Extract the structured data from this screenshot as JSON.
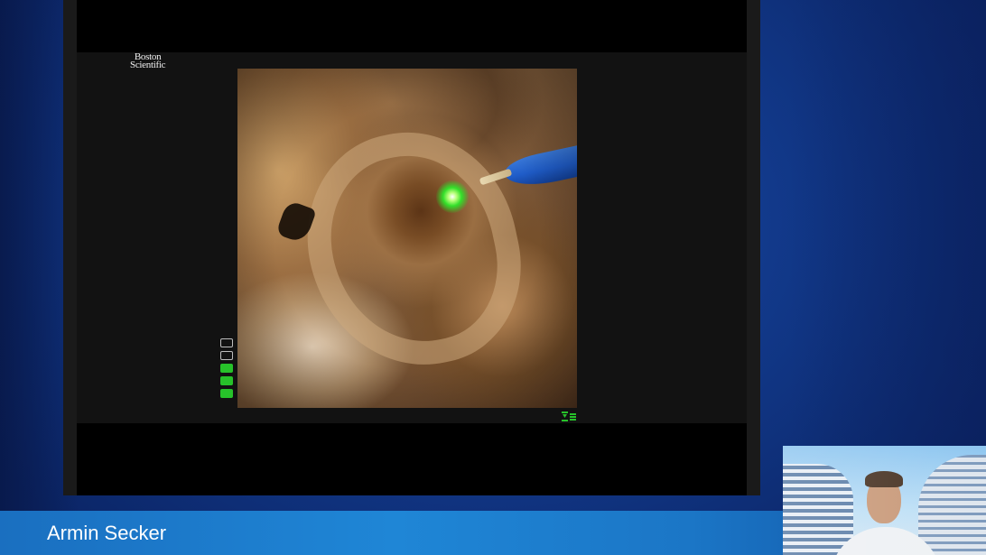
{
  "presentation": {
    "brand_logo_line1": "Boston",
    "brand_logo_line2": "Scientific",
    "speaker_name": "Armin Secker"
  },
  "video": {
    "level_meter": {
      "segments_total": 5,
      "segments_on": 3,
      "on_color": "#27c22a"
    },
    "icons": {
      "mode_indicator": "laser-mode-icon"
    }
  },
  "colors": {
    "background": "#123a8c",
    "speaker_bar": "#1f86d6",
    "laser_spot": "#33e02a",
    "laser_fiber": "#1f5cc8"
  }
}
